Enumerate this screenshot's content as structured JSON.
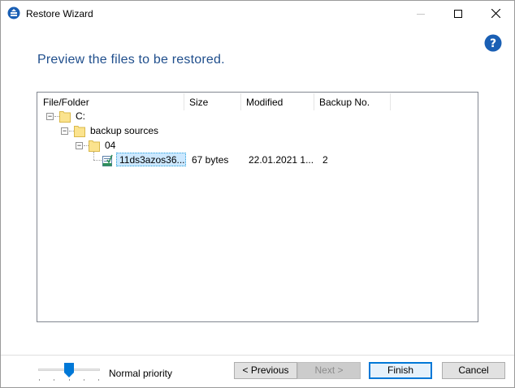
{
  "window": {
    "title": "Restore Wizard"
  },
  "heading": "Preview the files to be restored.",
  "columns": [
    "File/Folder",
    "Size",
    "Modified",
    "Backup No."
  ],
  "tree": [
    {
      "name": "C:"
    },
    {
      "name": "backup sources"
    },
    {
      "name": "04"
    },
    {
      "name": "11ds3azos36...",
      "size": "67 bytes",
      "modified": "22.01.2021 1...",
      "backup_no": "2"
    }
  ],
  "priority": {
    "label": "Normal priority",
    "level": 0.5
  },
  "buttons": {
    "previous": "< Previous",
    "next": "Next >",
    "finish": "Finish",
    "cancel": "Cancel"
  },
  "colors": {
    "heading": "#1f4e8c",
    "accent": "#0078d7",
    "selection": "#cce8ff"
  }
}
